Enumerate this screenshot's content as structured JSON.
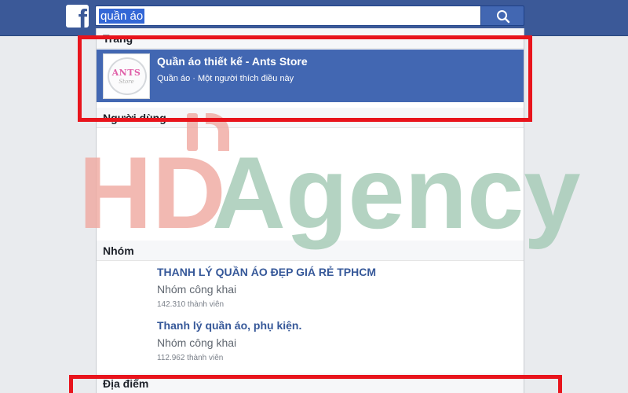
{
  "search": {
    "query": "quần áo"
  },
  "sections": {
    "pages": "Trang",
    "people": "Người dùng",
    "groups": "Nhóm",
    "places": "Địa điểm"
  },
  "page_result": {
    "name": "Quần áo thiết kế - Ants Store",
    "subtitle": "Quần áo · Một người thích điều này",
    "logo_text": "ANTS",
    "logo_sub": "Store"
  },
  "groups": [
    {
      "name": "THANH LÝ QUẦN ÁO ĐẸP GIÁ RẺ TPHCM",
      "type": "Nhóm công khai",
      "members": "142.310 thành viên"
    },
    {
      "name": "Thanh lý quần áo, phụ kiện.",
      "type": "Nhóm công khai",
      "members": "112.962 thành viên"
    }
  ],
  "watermark": {
    "part1": "HD",
    "part2": "Agency"
  },
  "colors": {
    "facebook_blue": "#3b5998",
    "selected_row": "#4267b2",
    "highlight_box": "#e8141c",
    "link_blue": "#365899",
    "watermark_red": "#f0a8a0",
    "watermark_green": "#a8ccb8"
  }
}
